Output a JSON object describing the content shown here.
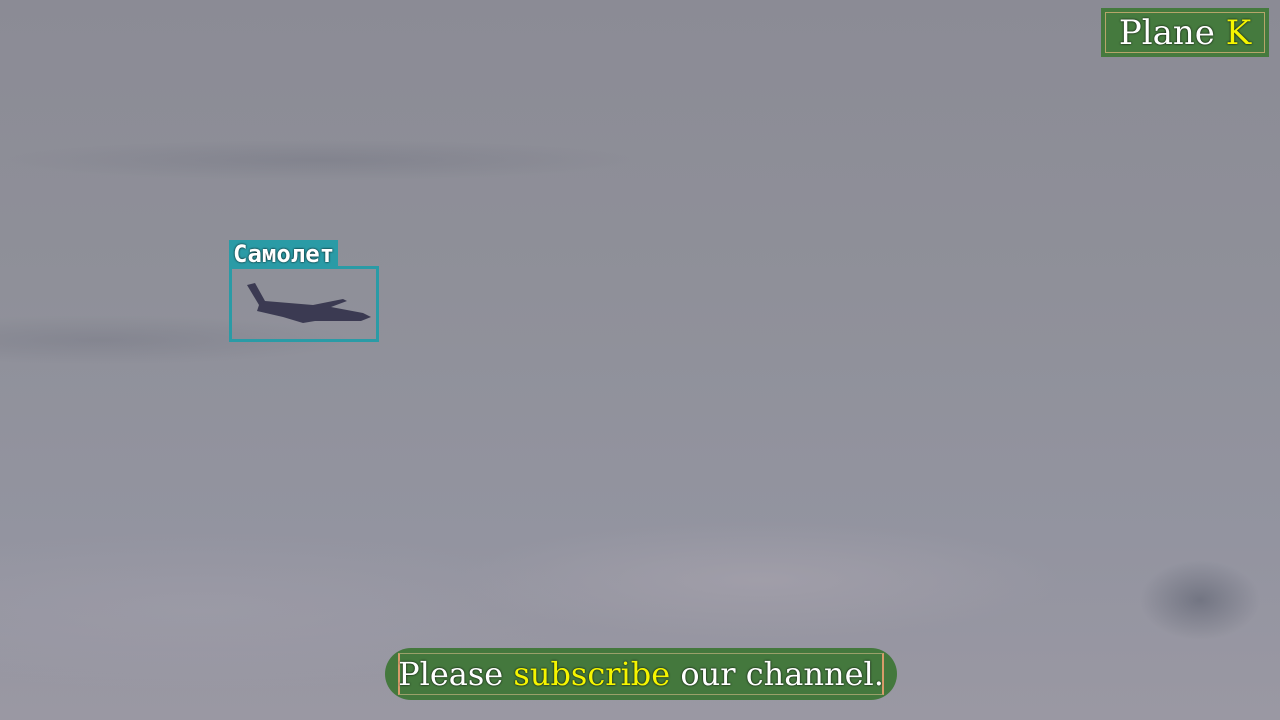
{
  "detection": {
    "label": "Самолет",
    "box_color": "#2a9ba6"
  },
  "logo": {
    "word": "Plane",
    "letter": "K"
  },
  "banner": {
    "before": "Please ",
    "highlight": "subscribe",
    "after": " our channel."
  },
  "colors": {
    "badge_green": "#457a3e",
    "highlight_yellow": "#f5f500"
  }
}
